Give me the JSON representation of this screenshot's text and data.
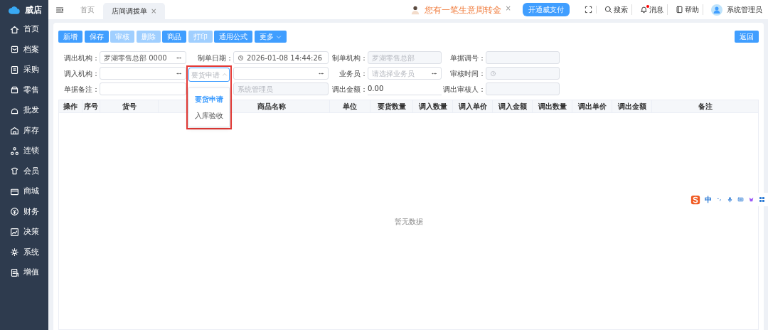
{
  "app": {
    "logo_text": "威店"
  },
  "sidebar": {
    "items": [
      {
        "label": "首页"
      },
      {
        "label": "档案"
      },
      {
        "label": "采购"
      },
      {
        "label": "零售"
      },
      {
        "label": "批发"
      },
      {
        "label": "库存"
      },
      {
        "label": "连锁"
      },
      {
        "label": "会员"
      },
      {
        "label": "商城"
      },
      {
        "label": "财务"
      },
      {
        "label": "决策"
      },
      {
        "label": "系统"
      },
      {
        "label": "增值"
      }
    ]
  },
  "tabs": [
    {
      "label": "首页",
      "selected": false
    },
    {
      "label": "店间调拨单",
      "selected": true,
      "close": "×"
    }
  ],
  "topbar": {
    "promo": {
      "text": "您有一笔生意周转金",
      "close": "×"
    },
    "promo_button": "开通威支付",
    "tools": [
      {
        "kind": "fullscreen"
      },
      {
        "kind": "search",
        "label": "搜索"
      },
      {
        "kind": "bell",
        "label": "消息",
        "badge": true
      },
      {
        "kind": "book",
        "label": "帮助"
      }
    ],
    "user": "系统管理员"
  },
  "toolbar": {
    "buttons": [
      {
        "label": "新增",
        "disabled": false
      },
      {
        "label": "保存",
        "disabled": false
      },
      {
        "label": "审核",
        "disabled": true
      },
      {
        "label": "删除",
        "disabled": true
      },
      {
        "label": "商品",
        "disabled": false
      },
      {
        "label": "打印",
        "disabled": true
      },
      {
        "label": "通用公式",
        "disabled": false
      },
      {
        "label": "更多",
        "disabled": false,
        "dropdown": true
      }
    ],
    "back": "返回"
  },
  "form": {
    "rows": [
      [
        {
          "label": "调出机构：",
          "kind": "lookup",
          "value": "罗湖零售总部  0000"
        },
        {
          "label": "制单日期：",
          "kind": "date",
          "value": "2026-01-08 14:44:26"
        },
        {
          "label": "制单机构：",
          "kind": "disabled",
          "value": "罗湖零售总部"
        },
        {
          "label": "单据调号：",
          "kind": "disabled"
        }
      ],
      [
        {
          "label": "调入机构：",
          "kind": "lookup"
        },
        {
          "kind": "lookup",
          "select": {
            "placeholder": "要货申请",
            "open": true,
            "highlight": true,
            "options": [
              {
                "label": "要货申请",
                "selected": true
              },
              {
                "label": "入库验收",
                "selected": false
              }
            ]
          }
        },
        {
          "label": "业务员：",
          "kind": "lookup",
          "placeholder": "请选择业务员"
        },
        {
          "label": "审核时间：",
          "kind": "date",
          "disabled": true
        }
      ],
      [
        {
          "label": "单据备注：",
          "kind": "text"
        },
        {
          "kind": "disabled",
          "value": "系统管理员"
        },
        {
          "label": "调出金额：",
          "kind": "amount",
          "value": "0.00"
        },
        {
          "label": "调出审核人：",
          "kind": "disabled"
        }
      ]
    ]
  },
  "table": {
    "columns": [
      {
        "label": "操作"
      },
      {
        "label": "序号"
      },
      {
        "label": "货号"
      },
      {
        "kind": "covered"
      },
      {
        "label": "商品名称"
      },
      {
        "label": "单位"
      },
      {
        "label": "要货数量"
      },
      {
        "label": "调入数量"
      },
      {
        "label": "调入单价"
      },
      {
        "label": "调入金额"
      },
      {
        "label": "调出数量"
      },
      {
        "label": "调出单价"
      },
      {
        "label": "调出金额"
      },
      {
        "label": "备注"
      }
    ],
    "empty_text": "暂无数据"
  },
  "ime_toolbar": {
    "mode": "中"
  }
}
